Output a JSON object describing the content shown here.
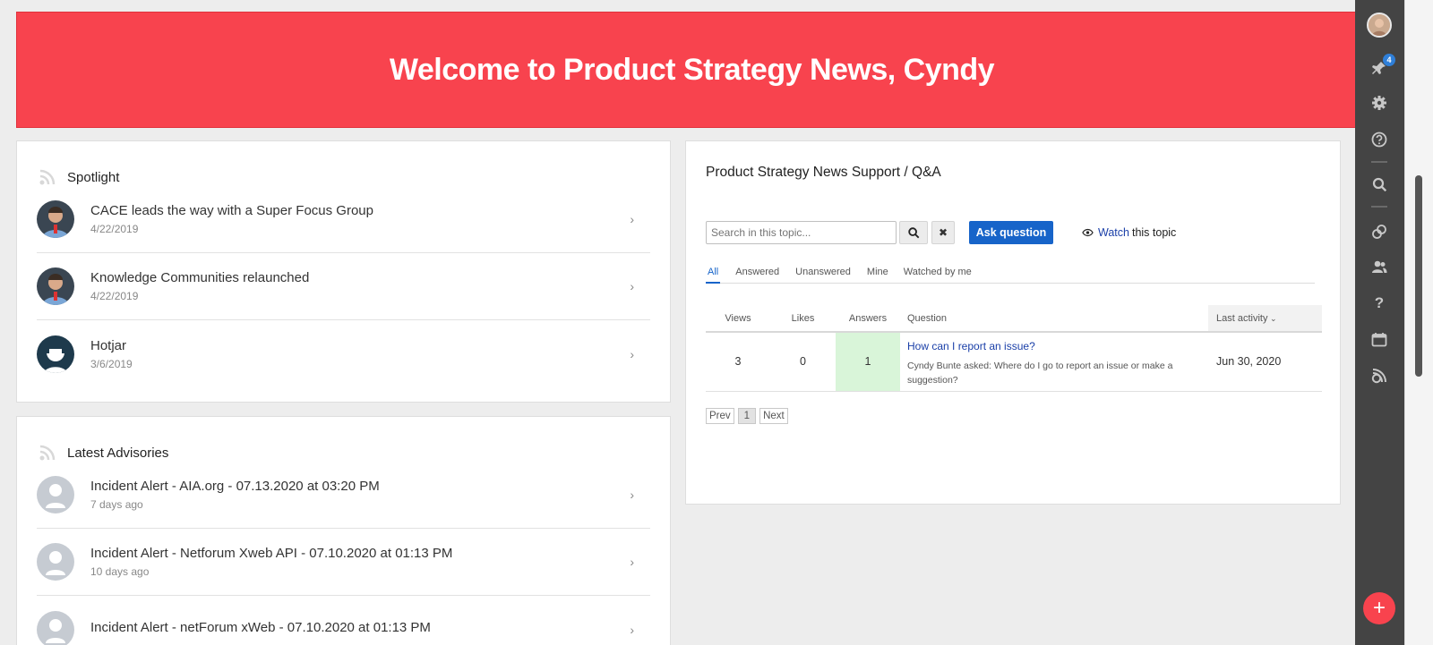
{
  "banner": {
    "title": "Welcome to Product Strategy News, Cyndy"
  },
  "spotlight": {
    "title": "Spotlight",
    "items": [
      {
        "title": "CACE leads the way with a Super Focus Group",
        "date": "4/22/2019"
      },
      {
        "title": "Knowledge Communities relaunched",
        "date": "4/22/2019"
      },
      {
        "title": "Hotjar",
        "date": "3/6/2019"
      }
    ]
  },
  "advisories": {
    "title": "Latest Advisories",
    "items": [
      {
        "title": "Incident Alert - AIA.org - 07.13.2020 at 03:20 PM",
        "date": "7 days ago"
      },
      {
        "title": "Incident Alert - Netforum Xweb API - 07.10.2020 at 01:13 PM",
        "date": "10 days ago"
      },
      {
        "title": "Incident Alert - netForum xWeb - 07.10.2020 at 01:13 PM",
        "date": ""
      }
    ]
  },
  "qa": {
    "title": "Product Strategy News Support / Q&A",
    "search_placeholder": "Search in this topic...",
    "ask_label": "Ask question",
    "watch_link": "Watch",
    "watch_rest": "this topic",
    "tabs": [
      "All",
      "Answered",
      "Unanswered",
      "Mine",
      "Watched by me"
    ],
    "columns": {
      "views": "Views",
      "likes": "Likes",
      "answers": "Answers",
      "question": "Question",
      "last": "Last activity"
    },
    "rows": [
      {
        "views": "3",
        "likes": "0",
        "answers": "1",
        "question": "How can I report an issue?",
        "excerpt": "Cyndy Bunte asked: Where do I go to report an issue or make a suggestion?",
        "last": "Jun 30, 2020"
      }
    ],
    "pager": {
      "prev": "Prev",
      "current": "1",
      "next": "Next"
    }
  },
  "sidebar": {
    "notification_count": "4",
    "fab": "+"
  },
  "colors": {
    "banner": "#f8434e",
    "accent": "#1764c9",
    "answered": "#d9f5d9",
    "sidebar": "#444444"
  }
}
